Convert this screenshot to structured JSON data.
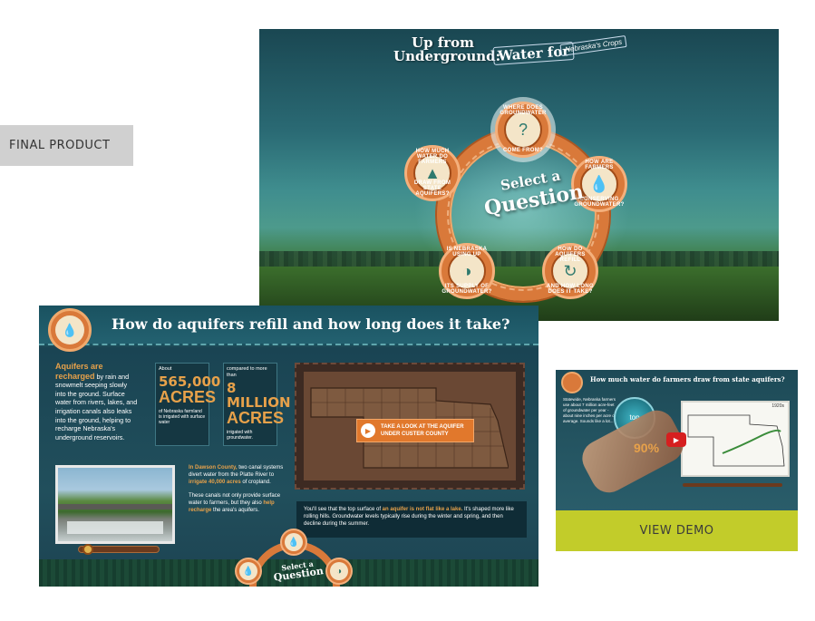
{
  "labels": {
    "final_product": "FINAL PRODUCT",
    "view_demo": "VIEW DEMO"
  },
  "top_screen": {
    "title_line1": "Up from",
    "title_line2": "Underground:",
    "title_water": "Water for",
    "title_crops": "Nebraska's Crops",
    "center_line1": "Select a",
    "center_line2": "Question",
    "nodes": [
      {
        "top": "WHERE DOES GROUNDWATER",
        "bottom": "COME FROM?",
        "icon": "question-icon"
      },
      {
        "top": "HOW ARE FARMERS",
        "bottom": "CONSERVING GROUNDWATER?",
        "icon": "hands-drop-icon"
      },
      {
        "top": "HOW DO AQUIFERS REFILL",
        "bottom": "AND HOW LONG DOES IT TAKE?",
        "icon": "drops-cycle-icon"
      },
      {
        "top": "IS NEBRASKA USING UP",
        "bottom": "ITS SUPPLY OF GROUNDWATER?",
        "icon": "gauge-drop-icon"
      },
      {
        "top": "HOW MUCH WATER DO FARMERS",
        "bottom": "DRAW FROM STATE AQUIFERS?",
        "icon": "well-icon"
      }
    ]
  },
  "main_screen": {
    "title": "How do aquifers refill and how long does it take?",
    "intro_highlight": "Aquifers are recharged",
    "intro_text": "by rain and snowmelt seeping slowly into the ground. Surface water from rivers, lakes, and irrigation canals also leaks into the ground, helping to recharge Nebraska's underground reservoirs.",
    "stat1": {
      "label": "About",
      "number": "565,000",
      "unit": "ACRES",
      "of": "of Nebraska farmland is irrigated with surface water"
    },
    "stat2": {
      "label": "compared to more than",
      "number": "8 MILLION",
      "unit": "ACRES",
      "foot": "irrigated with groundwater."
    },
    "map_cta_line1": "TAKE A LOOK AT THE AQUIFER",
    "map_cta_line2": "UNDER CUSTER COUNTY",
    "dawson_highlight": "In Dawson County,",
    "dawson_text": "two canal systems divert water from the Platte River to",
    "dawson_irrigate": "irrigate 40,000 acres",
    "dawson_of": "of cropland.",
    "dawson_p2a": "These canals not only provide surface water to farmers, but they also",
    "dawson_p2b": "help recharge",
    "dawson_p2c": "the area's aquifers.",
    "note_a": "You'll see that the top surface of",
    "note_highlight": "an aquifer is not flat like a lake.",
    "note_b": "It's shaped more like rolling hills. Groundwater levels typically rise during the winter and spring, and then decline during the summer.",
    "select_line1": "Select a",
    "select_line2": "Question"
  },
  "demo_screen": {
    "title": "How much water do farmers draw from state aquifers?",
    "side_text": "Statewide, Nebraska farmers use about 7 million acre-feet of groundwater per year - about nine inches per acre on average. Sounds like a lot...",
    "percent": "90%",
    "button_icon": "top",
    "year": "1920s"
  },
  "colors": {
    "accent_orange": "#d9793a",
    "highlight_yellow": "#e7a14a",
    "teal_bg": "#1d4a57",
    "demo_button": "#c2cc2a"
  }
}
